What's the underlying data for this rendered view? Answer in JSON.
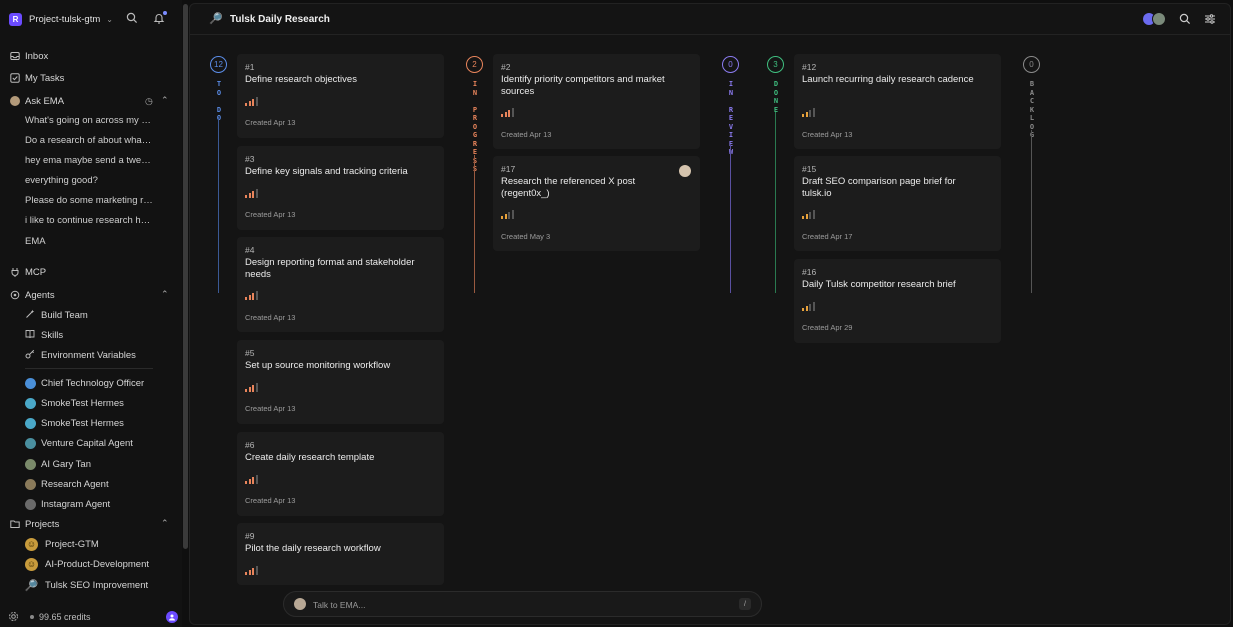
{
  "workspace": {
    "name": "Project-tulsk-gtm",
    "logo_letter": "R"
  },
  "nav": {
    "inbox": "Inbox",
    "my_tasks": "My Tasks",
    "ask_ema": "Ask EMA",
    "ask_ema_items": [
      "What's going on across my pr...",
      "Do a research of about what ...",
      "hey ema maybe send a tweet ...",
      "everything good?",
      "Please do some marketing re...",
      "i like to continue research how...",
      "EMA"
    ],
    "mcp": "MCP",
    "agents": "Agents",
    "agent_tools": [
      "Build Team",
      "Skills",
      "Environment Variables"
    ],
    "agent_list": [
      "Chief Technology Officer",
      "SmokeTest Hermes",
      "SmokeTest Hermes",
      "Venture Capital Agent",
      "AI Gary Tan",
      "Research Agent",
      "Instagram Agent"
    ],
    "projects": "Projects",
    "project_list": [
      "Project-GTM",
      "AI-Product-Development",
      "Tulsk SEO Improvement"
    ],
    "credits": "99.65 credits"
  },
  "header": {
    "title": "Tulsk Daily Research"
  },
  "columns": [
    {
      "label": "TO DO",
      "count": "12",
      "color": "#5b8de8"
    },
    {
      "label": "IN PROGRESS",
      "count": "2",
      "color": "#e8845b"
    },
    {
      "label": "IN REVIEW",
      "count": "0",
      "color": "#8b7bf0"
    },
    {
      "label": "DONE",
      "count": "3",
      "color": "#3fbf7f"
    },
    {
      "label": "BACKLOG",
      "count": "0",
      "color": "#8a8a8a"
    }
  ],
  "cards": {
    "todo": [
      {
        "id": "#1",
        "title": "Define research objectives",
        "date": "Created Apr 13"
      },
      {
        "id": "#3",
        "title": "Define key signals and tracking criteria",
        "date": "Created Apr 13"
      },
      {
        "id": "#4",
        "title": "Design reporting format and stakeholder needs",
        "date": "Created Apr 13"
      },
      {
        "id": "#5",
        "title": "Set up source monitoring workflow",
        "date": "Created Apr 13"
      },
      {
        "id": "#6",
        "title": "Create daily research template",
        "date": "Created Apr 13"
      },
      {
        "id": "#9",
        "title": "Pilot the daily research workflow",
        "date": ""
      }
    ],
    "in_progress": [
      {
        "id": "#2",
        "title": "Identify priority competitors and market sources",
        "date": "Created Apr 13"
      },
      {
        "id": "#17",
        "title": "Research the referenced X post (regent0x_)",
        "date": "Created May 3"
      }
    ],
    "done": [
      {
        "id": "#12",
        "title": "Launch recurring daily research cadence",
        "date": "Created Apr 13"
      },
      {
        "id": "#15",
        "title": "Draft SEO comparison page brief for tulsk.io",
        "date": "Created Apr 17"
      },
      {
        "id": "#16",
        "title": "Daily Tulsk competitor research brief",
        "date": "Created Apr 29"
      }
    ]
  },
  "chat": {
    "placeholder": "Talk to EMA...",
    "shortcut": "/"
  },
  "icons": {
    "search": "search-icon",
    "bell": "bell-icon",
    "settings": "sliders-icon",
    "gear": "gear-icon"
  }
}
